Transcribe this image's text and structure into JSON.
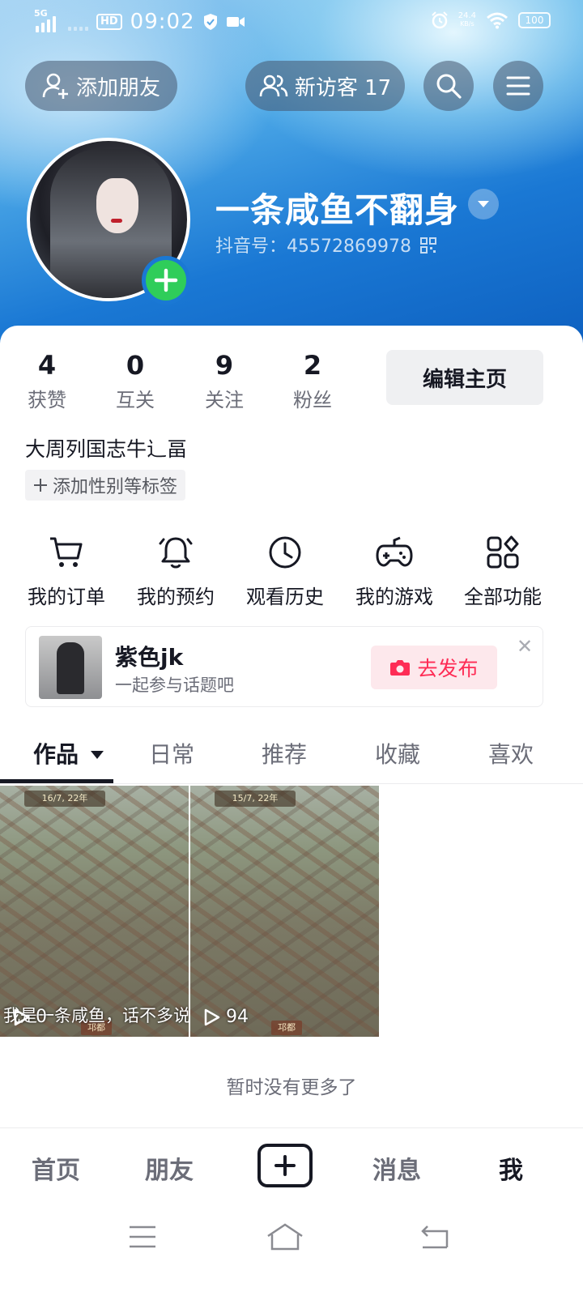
{
  "status_bar": {
    "network": "5G",
    "hd": "HD",
    "time": "09:02",
    "speed_value": "24.4",
    "speed_unit": "KB/s",
    "battery": "100"
  },
  "header": {
    "add_friend_label": "添加朋友",
    "visitors_label": "新访客 17"
  },
  "profile": {
    "name": "一条咸鱼不翻身",
    "douyin_id": "抖音号：45572869978"
  },
  "stats": [
    {
      "value": "4",
      "label": "获赞"
    },
    {
      "value": "0",
      "label": "互关"
    },
    {
      "value": "9",
      "label": "关注"
    },
    {
      "value": "2",
      "label": "粉丝"
    }
  ],
  "edit_profile_label": "编辑主页",
  "bio": "大周列国志牛辶畐",
  "tag_button_label": "添加性别等标签",
  "functions": [
    {
      "label": "我的订单",
      "icon": "cart-icon"
    },
    {
      "label": "我的预约",
      "icon": "bell-icon"
    },
    {
      "label": "观看历史",
      "icon": "clock-icon"
    },
    {
      "label": "我的游戏",
      "icon": "gamepad-icon"
    },
    {
      "label": "全部功能",
      "icon": "grid-icon"
    }
  ],
  "promo": {
    "title": "紫色jk",
    "subtitle": "一起参与话题吧",
    "button_label": "去发布"
  },
  "tabs": [
    {
      "label": "作品",
      "active": true
    },
    {
      "label": "日常"
    },
    {
      "label": "推荐"
    },
    {
      "label": "收藏"
    },
    {
      "label": "喜欢"
    }
  ],
  "videos": [
    {
      "caption": "我是一条咸鱼，话不多说，",
      "plays": "0",
      "hud": "16/7, 22年",
      "place": "邛都"
    },
    {
      "caption": "",
      "plays": "94",
      "hud": "15/7, 22年",
      "place": "邛都"
    }
  ],
  "no_more_text": "暂时没有更多了",
  "bottom_nav": [
    {
      "label": "首页"
    },
    {
      "label": "朋友"
    },
    {
      "label": "消息"
    },
    {
      "label": "我",
      "active": true
    }
  ]
}
